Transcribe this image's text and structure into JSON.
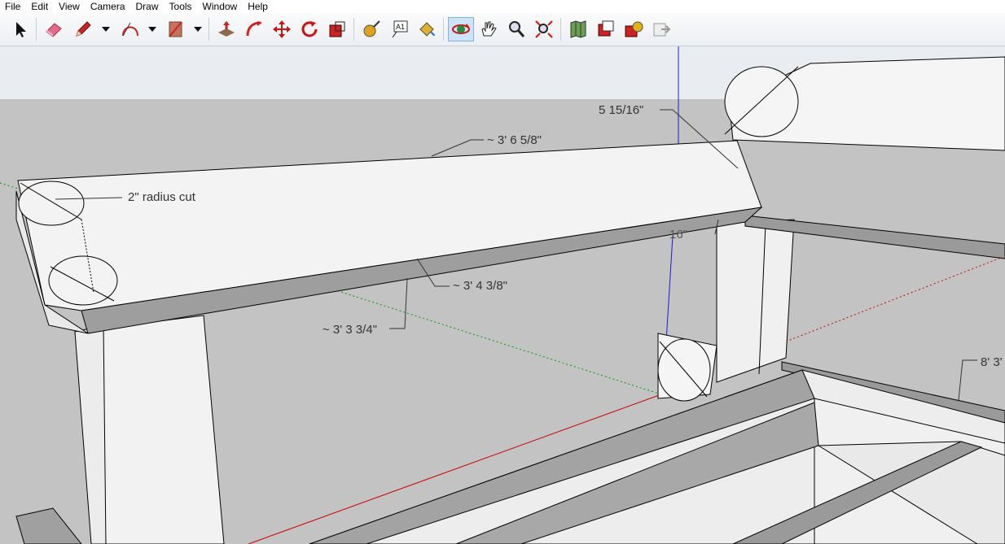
{
  "menu": [
    "File",
    "Edit",
    "View",
    "Camera",
    "Draw",
    "Tools",
    "Window",
    "Help"
  ],
  "toolbar": {
    "tools": [
      {
        "name": "select-tool",
        "icon": "arrow-cursor-icon"
      },
      {
        "name": "eraser-tool",
        "icon": "eraser-icon"
      },
      {
        "name": "pencil-tool",
        "icon": "pencil-icon"
      },
      {
        "name": "arc-tool",
        "icon": "arc-icon"
      },
      {
        "name": "rectangle-tool",
        "icon": "rectangle-icon"
      },
      {
        "name": "push-pull-tool",
        "icon": "push-pull-icon"
      },
      {
        "name": "follow-me-tool",
        "icon": "follow-me-icon"
      },
      {
        "name": "move-tool",
        "icon": "move-icon"
      },
      {
        "name": "rotate-tool",
        "icon": "rotate-icon"
      },
      {
        "name": "scale-tool",
        "icon": "scale-icon"
      },
      {
        "name": "tape-measure-tool",
        "icon": "tape-measure-icon"
      },
      {
        "name": "text-tool",
        "icon": "text-icon",
        "label": "A1"
      },
      {
        "name": "paint-bucket-tool",
        "icon": "paint-bucket-icon"
      },
      {
        "name": "orbit-tool",
        "icon": "orbit-icon",
        "active": true
      },
      {
        "name": "pan-tool",
        "icon": "pan-hand-icon"
      },
      {
        "name": "zoom-tool",
        "icon": "zoom-icon"
      },
      {
        "name": "zoom-extents-tool",
        "icon": "zoom-extents-icon"
      },
      {
        "name": "3d-warehouse-button",
        "icon": "map-icon"
      },
      {
        "name": "share-model-button",
        "icon": "share-model-icon"
      },
      {
        "name": "extension-warehouse-button",
        "icon": "extension-icon"
      },
      {
        "name": "send-to-layout-button",
        "icon": "layout-icon"
      }
    ]
  },
  "dimensions": {
    "top_edge": "~ 3' 6 5/8\"",
    "radius_note": "2\" radius cut",
    "bottom_edge": "~ 3' 4 3/8\"",
    "lower_edge": "~ 3' 3 3/4\"",
    "right_thickness": "5 15/16\"",
    "hidden_dim": "16\"",
    "far_right": "8' 3'"
  },
  "colors": {
    "sky_top": "#e9edf1",
    "ground": "#c3c3c3",
    "face_light": "#f2f2f2",
    "face_shade": "#9a9a9a",
    "axis_red": "#cc0000",
    "axis_green": "#009900",
    "axis_blue": "#0000cc",
    "active_tool_bg": "#cde3f7"
  }
}
